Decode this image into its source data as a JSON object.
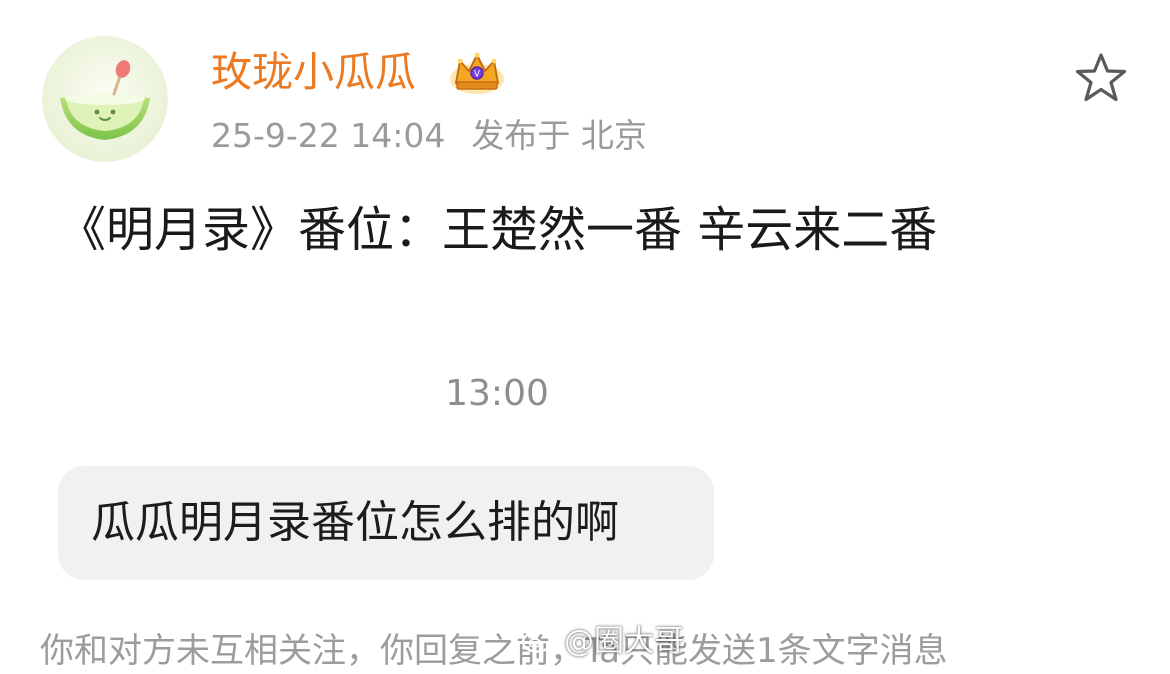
{
  "post": {
    "author": {
      "name": "玫珑小瓜瓜",
      "avatar_icon": "melon-avatar-icon",
      "badge_icon": "crown-badge-icon"
    },
    "timestamp": "25-9-22 14:04",
    "location_prefix": "发布于",
    "location": "北京",
    "favorite_icon": "star-outline-icon",
    "text": "《明月录》番位：王楚然一番 辛云来二番"
  },
  "chat": {
    "time": "13:00",
    "message": "瓜瓜明月录番位怎么排的啊",
    "notice": "你和对方未互相关注，你回复之前，Ta只能发送1条文字消息"
  },
  "watermark": {
    "text": "@圈大哥",
    "icon": "weibo-logo-icon"
  },
  "colors": {
    "username": "#eb7a22",
    "meta_text": "#9a9a9a",
    "bubble_bg": "#f1f1f1",
    "background": "#ffffff"
  }
}
